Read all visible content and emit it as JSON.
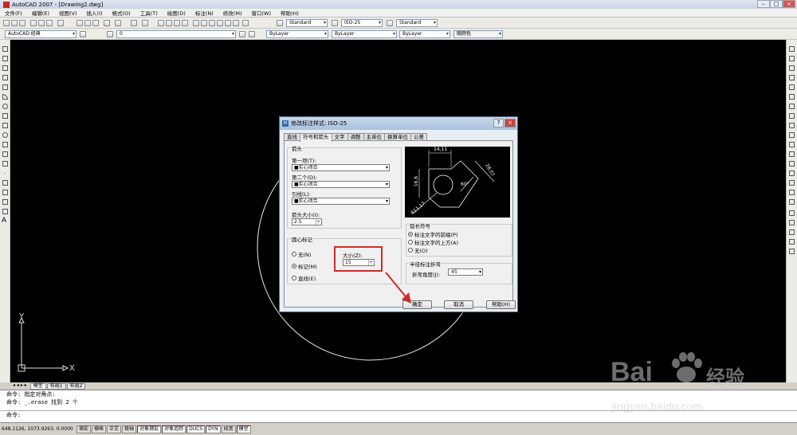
{
  "window": {
    "title": "AutoCAD 2007 - [Drawing2.dwg]"
  },
  "menu": [
    "文件(F)",
    "编辑(E)",
    "视图(V)",
    "插入(I)",
    "格式(O)",
    "工具(T)",
    "绘图(D)",
    "标注(N)",
    "修改(M)",
    "窗口(W)",
    "帮助(H)"
  ],
  "toolbar1": {
    "text_style": "Standard",
    "dim_style": "ISO-25",
    "table_style": "Standard"
  },
  "toolbar2": {
    "workspace": "AutoCAD 经典",
    "layer": "0",
    "color": "ByLayer",
    "linetype": "ByLayer",
    "lineweight": "ByLayer",
    "plotstyle": "随颜色"
  },
  "canvas": {
    "ucs_x": "X",
    "ucs_y": "Y"
  },
  "layout_tabs": [
    "模型",
    "布局1",
    "布局2"
  ],
  "command": {
    "lines": [
      "命令: 指定对角点:",
      "命令: _.erase 找到 2 个"
    ],
    "prompt": "命令:"
  },
  "status": {
    "coords": "648.1126, 1073.9263, 0.0000",
    "buttons": [
      "捕捉",
      "栅格",
      "正交",
      "极轴",
      "对象捕捉",
      "对象追踪",
      "DUCS",
      "DYN",
      "线宽",
      "模型"
    ]
  },
  "dialog": {
    "title": "修改标注样式: ISO-25",
    "tabs": [
      "直线",
      "符号和箭头",
      "文字",
      "调整",
      "主单位",
      "换算单位",
      "公差"
    ],
    "arrow_group": "箭头",
    "first_label": "第一项(T):",
    "first_value": "■实心闭合",
    "second_label": "第二个(D):",
    "second_value": "■实心闭合",
    "leader_label": "引线(L):",
    "leader_value": "■实心闭合",
    "arrow_size_label": "箭头大小(I):",
    "arrow_size_value": "2.5",
    "center_group": "圆心标记",
    "center_none": "无(N)",
    "center_mark": "标记(M)",
    "center_line": "直线(E)",
    "size_label": "大小(Z):",
    "size_value": "15",
    "arc_group": "弧长符号",
    "arc_before": "标注文字的前缀(P)",
    "arc_above": "标注文字的上方(A)",
    "arc_none": "无(O)",
    "jog_group": "半径标注折弯",
    "jog_angle_label": "折弯角度(J):",
    "jog_angle_value": "45",
    "ok": "确定",
    "cancel": "取消",
    "help": "帮助(H)",
    "preview_labels": [
      "14,11",
      "16,6",
      "28,07",
      "60°",
      "R11,17"
    ]
  },
  "watermark": {
    "brand": "Bai",
    "brand2": "经验",
    "url": "jingyan.baidu.com"
  }
}
